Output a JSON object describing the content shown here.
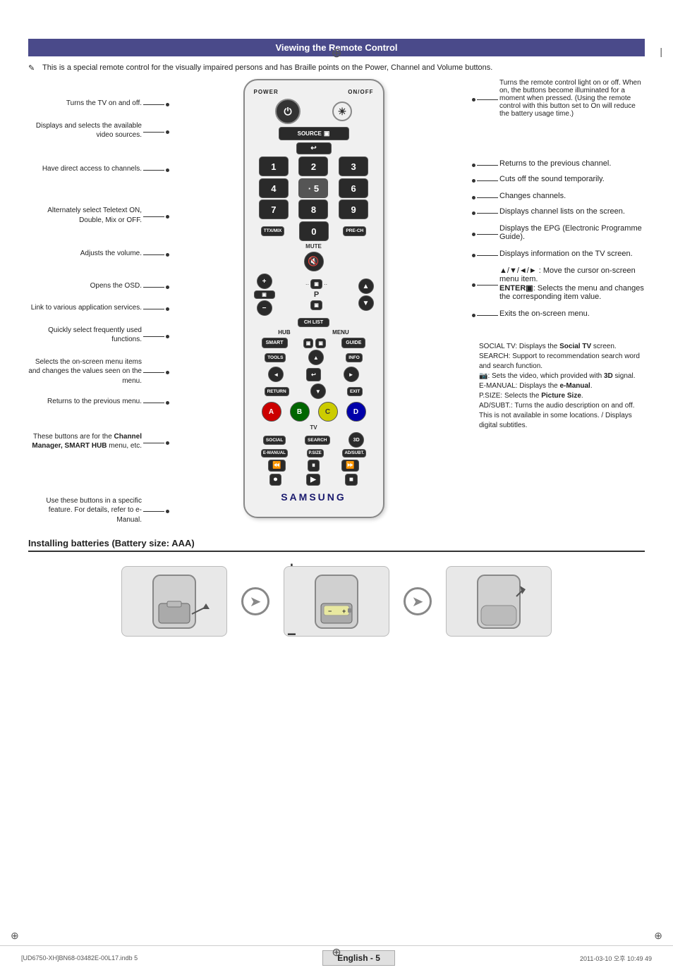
{
  "page": {
    "title": "Viewing the Remote Control",
    "note": "This is a special remote control for the visually impaired persons and has Braille points on the Power, Channel and Volume buttons."
  },
  "left_labels": [
    {
      "id": "lbl-power",
      "text": "Turns the TV on and off."
    },
    {
      "id": "lbl-source",
      "text": "Displays and selects the available video sources."
    },
    {
      "id": "lbl-channels",
      "text": "Have direct access to channels."
    },
    {
      "id": "lbl-ttx",
      "text": "Alternately select Teletext ON, Double, Mix or OFF."
    },
    {
      "id": "lbl-vol",
      "text": "Adjusts the volume."
    },
    {
      "id": "lbl-osd",
      "text": "Opens the OSD."
    },
    {
      "id": "lbl-smart",
      "text": "Link to various application services."
    },
    {
      "id": "lbl-tools",
      "text": "Quickly select frequently used functions."
    },
    {
      "id": "lbl-menu",
      "text": "Selects the on-screen menu items and changes the values seen on the menu."
    },
    {
      "id": "lbl-return",
      "text": "Returns to the previous menu."
    },
    {
      "id": "lbl-color",
      "text": "These buttons are for the Channel Manager, SMART HUB menu, etc."
    },
    {
      "id": "lbl-feature",
      "text": "Use these buttons in a specific feature. For details, refer to e-Manual."
    }
  ],
  "right_labels": [
    {
      "id": "rlbl-onoff",
      "text": "Turns the remote control light on or off. When on, the buttons become illuminated for a moment when pressed. (Using the remote control with this button set to On will reduce the battery usage time.)"
    },
    {
      "id": "rlbl-prech",
      "text": "Returns to the previous channel."
    },
    {
      "id": "rlbl-mute",
      "text": "Cuts off the sound temporarily."
    },
    {
      "id": "rlbl-ch",
      "text": "Changes channels."
    },
    {
      "id": "rlbl-chlist",
      "text": "Displays channel lists on the screen."
    },
    {
      "id": "rlbl-guide",
      "text": "Displays the EPG (Electronic Programme Guide)."
    },
    {
      "id": "rlbl-info",
      "text": "Displays information on the TV screen."
    },
    {
      "id": "rlbl-nav",
      "text": "▲/▼/◄/► : Move the cursor on-screen menu item. ENTER▣: Selects the menu and changes the corresponding item value."
    },
    {
      "id": "rlbl-exit",
      "text": "Exits the on-screen menu."
    },
    {
      "id": "rlbl-social",
      "text": "SOCIAL TV: Displays the Social TV screen. SEARCH: Support to recommendation search word and search function. 📷: Sets the video, which provided with 3D signal. E-MANUAL: Displays the e-Manual. P.SIZE: Selects the Picture Size. AD/SUBT.: Turns the audio description on and off. This is not available in some locations. / Displays digital subtitles."
    }
  ],
  "remote": {
    "power_label": "POWER",
    "onoff_label": "ON/OFF",
    "source_label": "SOURCE",
    "mute_label": "MUTE",
    "ttx_label": "TTX/MIX",
    "prech_label": "PRE-CH",
    "hub_label": "HUB",
    "menu_label": "MENU",
    "smart_label": "SMART",
    "guide_label": "GUIDE",
    "tools_label": "TOOLS",
    "info_label": "INFO",
    "return_label": "RETURN",
    "exit_label": "EXIT",
    "ch_list_label": "CH LIST",
    "social_label": "SOCIAL",
    "search_label": "SEARCH",
    "emanual_label": "E-MANUAL",
    "psize_label": "P.SIZE",
    "adsubt_label": "AD/SUBT.",
    "samsung_logo": "SAMSUNG",
    "numbers": [
      "1",
      "2",
      "3",
      "4",
      "5",
      "6",
      "7",
      "8",
      "9",
      "0"
    ],
    "color_btns": [
      "A",
      "B",
      "C",
      "D"
    ]
  },
  "battery_section": {
    "title": "Installing batteries (Battery size: AAA)"
  },
  "footer": {
    "left": "[UD6750-XH]BN68-03482E-00L17.indb   5",
    "center": "English - 5",
    "right": "2011-03-10   오후 10:49 49"
  }
}
